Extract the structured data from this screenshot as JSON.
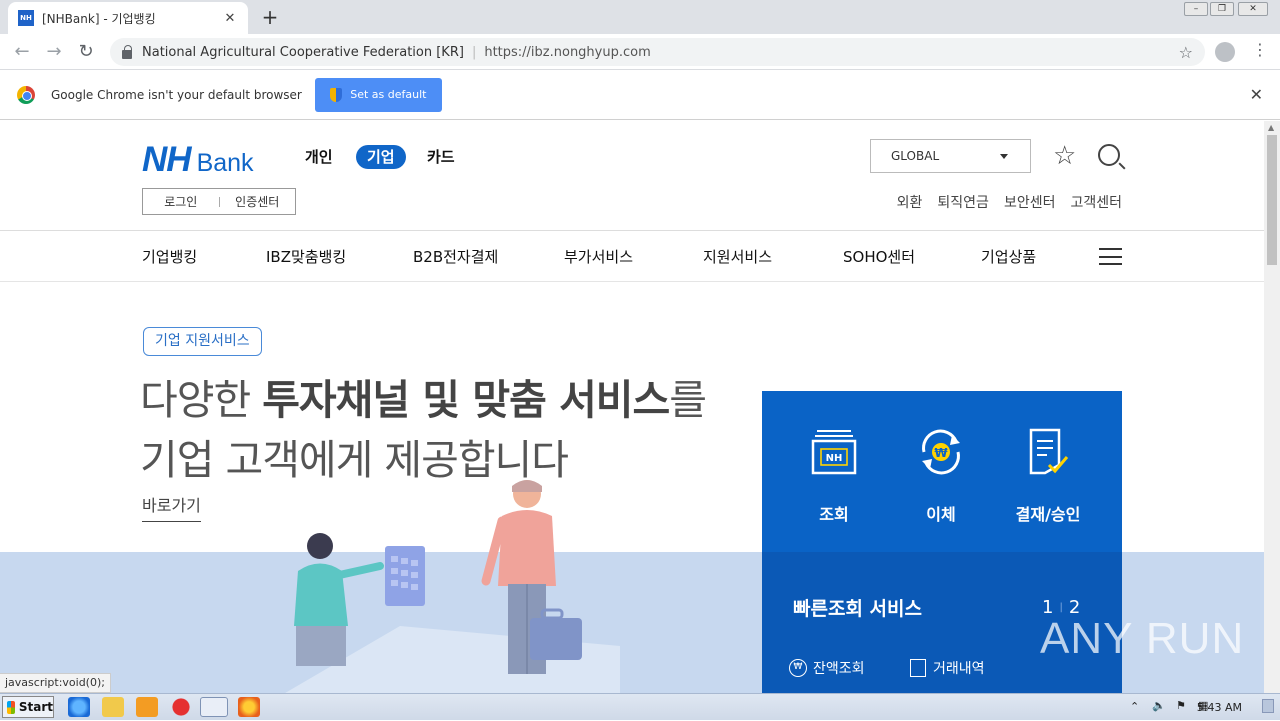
{
  "browser": {
    "tab_title": "[NHBank] - 기업뱅킹",
    "tab_favicon": "NH",
    "new_tab": "+",
    "site_identity": "National Agricultural Cooperative Federation [KR]",
    "url": "https://ibz.nonghyup.com",
    "infobar_text": "Google Chrome isn't your default browser",
    "infobar_button": "Set as default",
    "status_url": "javascript:void(0);"
  },
  "header": {
    "logo_nh": "NH",
    "logo_bank": "Bank",
    "segments": [
      "개인",
      "기업",
      "카드"
    ],
    "active_segment": "기업",
    "global_select": "GLOBAL",
    "login": "로그인",
    "cert": "인증센터",
    "util_links": [
      "외환",
      "퇴직연금",
      "보안센터",
      "고객센터"
    ]
  },
  "gnb": [
    "기업뱅킹",
    "IBZ맞춤뱅킹",
    "B2B전자결제",
    "부가서비스",
    "지원서비스",
    "SOHO센터",
    "기업상품"
  ],
  "hero": {
    "tag": "기업 지원서비스",
    "line1_pre": "다양한 ",
    "line1_bold": "투자채널 및 맞춤 서비스",
    "line1_post": "를",
    "line2": "기업 고객에게 제공합니다",
    "link": "바로가기"
  },
  "quick": {
    "items": [
      "조회",
      "이체",
      "결재/승인"
    ],
    "nh_badge": "NH",
    "won_symbol": "₩",
    "title": "빠른조회 서비스",
    "page1": "1",
    "page2": "2",
    "links": [
      "잔액조회",
      "거래내역"
    ]
  },
  "watermark": "ANY RUN",
  "taskbar": {
    "start": "Start",
    "clock": "5:43 AM"
  },
  "colors": {
    "brand_blue": "#1066c8",
    "panel_blue": "#0a63c6",
    "hero_band": "#c7d8ef"
  }
}
